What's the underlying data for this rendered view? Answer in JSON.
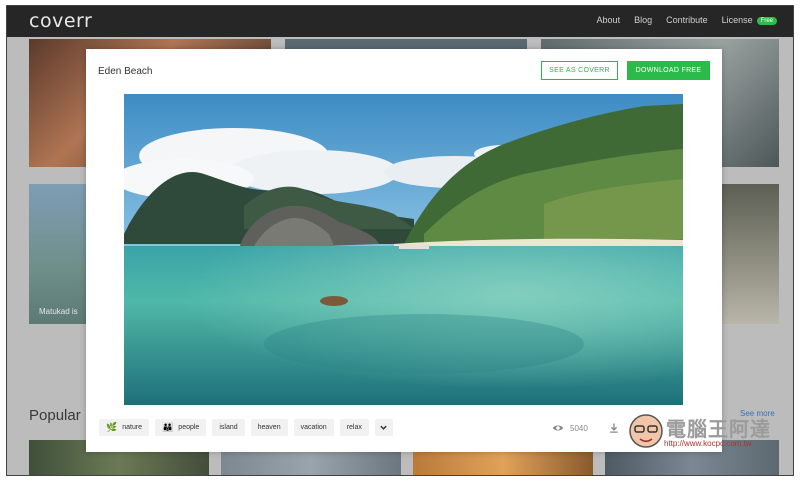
{
  "app": {
    "logo": "coverr",
    "nav": [
      {
        "label": "About"
      },
      {
        "label": "Blog"
      },
      {
        "label": "Contribute"
      },
      {
        "label": "License",
        "badge": "Free"
      }
    ]
  },
  "background": {
    "tile_caption": "Matukad is",
    "popular_heading": "Popular",
    "see_more": "See more"
  },
  "modal": {
    "title": "Eden Beach",
    "see_as_coverr": "SEE AS COVERR",
    "download_free": "DOWNLOAD FREE",
    "tags": [
      {
        "label": "nature",
        "icon": "leaf-person-icon"
      },
      {
        "label": "people",
        "icon": "family-icon"
      },
      {
        "label": "island"
      },
      {
        "label": "heaven"
      },
      {
        "label": "vacation"
      },
      {
        "label": "relax"
      }
    ],
    "stats": {
      "views": "5040"
    }
  },
  "watermark": {
    "text": "電腦王阿達",
    "url": "http://www.kocpc.com.tw"
  },
  "colors": {
    "accent_green": "#2cba4b",
    "topbar": "#262626"
  }
}
